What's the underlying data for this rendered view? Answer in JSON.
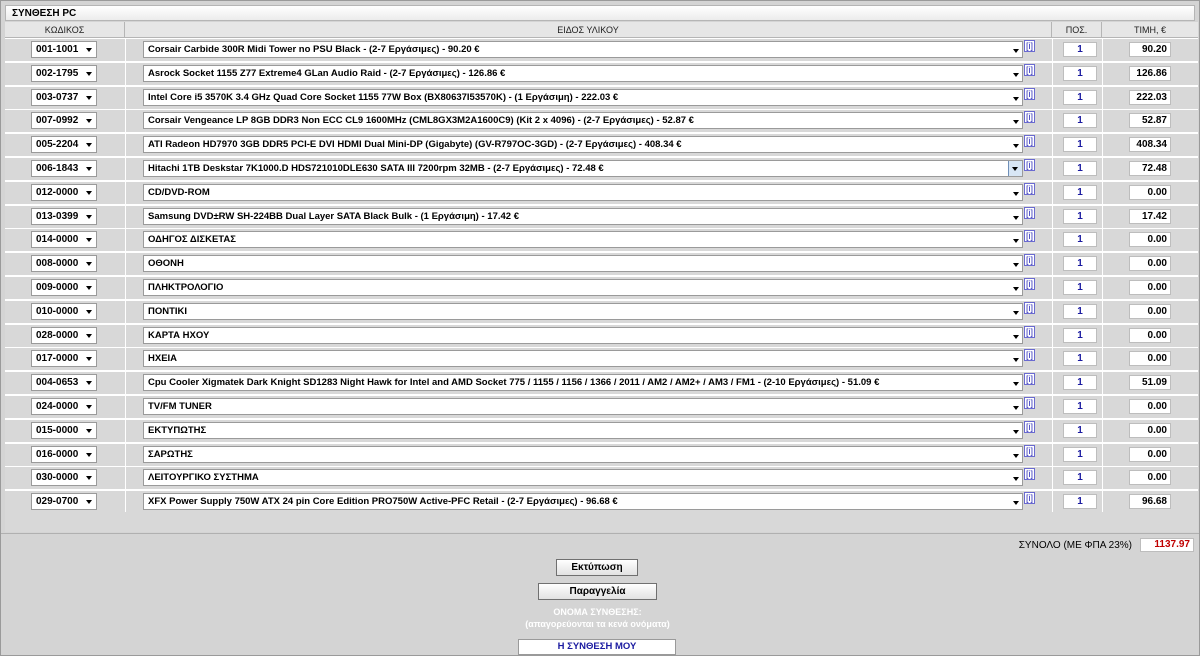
{
  "title": "ΣΥΝΘΕΣΗ PC",
  "columns": {
    "code": "ΚΩΔΙΚΟΣ",
    "description": "ΕΙΔΟΣ ΥΛΙΚΟΥ",
    "qty": "ΠΟΣ.",
    "price": "ΤΙΜΗ, €"
  },
  "info_label": "[i]",
  "rows": [
    {
      "code": "001-1001",
      "description": "Corsair Carbide 300R Midi Tower no PSU Black - (2-7 Εργάσιμες) - 90.20 €",
      "qty": "1",
      "price": "90.20"
    },
    {
      "code": "002-1795",
      "description": "Asrock Socket 1155 Z77 Extreme4 GLan Audio Raid - (2-7 Εργάσιμες) - 126.86 €",
      "qty": "1",
      "price": "126.86"
    },
    {
      "code": "003-0737",
      "description": "Intel Core i5 3570K 3.4 GHz Quad Core Socket 1155 77W Box (BX80637I53570K) - (1 Εργάσιμη) - 222.03 €",
      "qty": "1",
      "price": "222.03"
    },
    {
      "code": "007-0992",
      "description": "Corsair Vengeance LP 8GB DDR3 Non ECC CL9 1600MHz (CML8GX3M2A1600C9) (Kit 2 x 4096) - (2-7 Εργάσιμες) - 52.87 €",
      "qty": "1",
      "price": "52.87"
    },
    {
      "code": "005-2204",
      "description": "ATI Radeon HD7970 3GB DDR5 PCI-E DVI HDMI Dual Mini-DP (Gigabyte) (GV-R797OC-3GD) - (2-7 Εργάσιμες) - 408.34 €",
      "qty": "1",
      "price": "408.34"
    },
    {
      "code": "006-1843",
      "description": "Hitachi 1TB Deskstar 7K1000.D HDS721010DLE630 SATA III 7200rpm 32MB - (2-7 Εργάσιμες) - 72.48 €",
      "qty": "1",
      "price": "72.48"
    },
    {
      "code": "012-0000",
      "description": "CD/DVD-ROM",
      "qty": "1",
      "price": "0.00"
    },
    {
      "code": "013-0399",
      "description": "Samsung DVD±RW SH-224BB Dual Layer SATA Black Bulk - (1 Εργάσιμη) - 17.42 €",
      "qty": "1",
      "price": "17.42"
    },
    {
      "code": "014-0000",
      "description": "ΟΔΗΓΟΣ ΔΙΣΚΕΤΑΣ",
      "qty": "1",
      "price": "0.00"
    },
    {
      "code": "008-0000",
      "description": "ΟΘΟΝΗ",
      "qty": "1",
      "price": "0.00"
    },
    {
      "code": "009-0000",
      "description": "ΠΛΗΚΤΡΟΛΟΓΙΟ",
      "qty": "1",
      "price": "0.00"
    },
    {
      "code": "010-0000",
      "description": "ΠΟΝΤΙΚΙ",
      "qty": "1",
      "price": "0.00"
    },
    {
      "code": "028-0000",
      "description": "ΚΑΡΤΑ ΗΧΟΥ",
      "qty": "1",
      "price": "0.00"
    },
    {
      "code": "017-0000",
      "description": "ΗΧΕΙΑ",
      "qty": "1",
      "price": "0.00"
    },
    {
      "code": "004-0653",
      "description": "Cpu Cooler Xigmatek Dark Knight SD1283 Night Hawk for Intel and AMD Socket 775 / 1155 / 1156 / 1366 / 2011 / AM2 / AM2+ / AM3 / FM1 - (2-10 Εργάσιμες) - 51.09 €",
      "qty": "1",
      "price": "51.09"
    },
    {
      "code": "024-0000",
      "description": "TV/FM TUNER",
      "qty": "1",
      "price": "0.00"
    },
    {
      "code": "015-0000",
      "description": "ΕΚΤΥΠΩΤΗΣ",
      "qty": "1",
      "price": "0.00"
    },
    {
      "code": "016-0000",
      "description": "ΣΑΡΩΤΗΣ",
      "qty": "1",
      "price": "0.00"
    },
    {
      "code": "030-0000",
      "description": "ΛΕΙΤΟΥΡΓΙΚΟ ΣΥΣΤΗΜΑ",
      "qty": "1",
      "price": "0.00"
    },
    {
      "code": "029-0700",
      "description": "XFX Power Supply 750W ATX 24 pin Core Edition PRO750W Active-PFC Retail - (2-7 Εργάσιμες) - 96.68 €",
      "qty": "1",
      "price": "96.68"
    }
  ],
  "active_row": 5,
  "total": {
    "label": "ΣΥΝΟΛΟ (ΜΕ ΦΠΑ 23%)",
    "value": "1137.97"
  },
  "buttons": {
    "print": "Εκτύπωση",
    "order": "Παραγγελία"
  },
  "name_section": {
    "label": "ΟΝΟΜΑ ΣΥΝΘΕΣΗΣ:",
    "hint": "(απαγορεύονται τα κενά ονόματα)",
    "value": "Η ΣΥΝΘΕΣΗ ΜΟΥ"
  },
  "colors": {
    "total_value": "#c00000",
    "qty_text": "#1a1aa0"
  }
}
